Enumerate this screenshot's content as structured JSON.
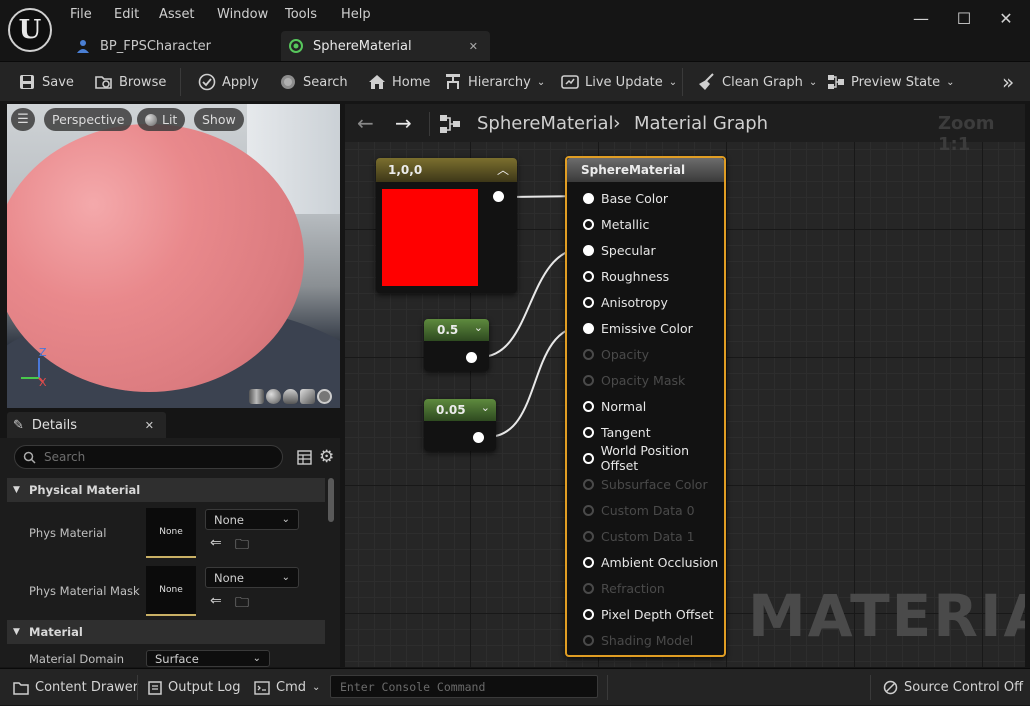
{
  "app": {
    "logo": "U"
  },
  "menu": [
    "File",
    "Edit",
    "Asset",
    "Window",
    "Tools",
    "Help"
  ],
  "window_controls": {
    "minimize": "—",
    "maximize": "☐",
    "close": "✕"
  },
  "tabs": [
    {
      "label": "BP_FPSCharacter",
      "icon": "person-icon"
    },
    {
      "label": "SphereMaterial",
      "icon": "material-icon",
      "active": true,
      "close": "✕"
    }
  ],
  "toolbar": {
    "save": "Save",
    "browse": "Browse",
    "apply": "Apply",
    "search": "Search",
    "home": "Home",
    "hierarchy": "Hierarchy",
    "live_update": "Live Update",
    "clean_graph": "Clean Graph",
    "preview_state": "Preview State",
    "more": "»"
  },
  "viewport": {
    "perspective": "Perspective",
    "lit": "Lit",
    "show": "Show",
    "axis_z": "Z",
    "axis_x": "X",
    "sphere_color": "#e7878a"
  },
  "details": {
    "tab_label": "Details",
    "close": "✕",
    "search_placeholder": "Search",
    "categories": {
      "physical": "Physical Material",
      "material": "Material"
    },
    "phys_material": {
      "label": "Phys Material",
      "thumb": "None",
      "value": "None"
    },
    "phys_material_mask": {
      "label": "Phys Material Mask",
      "thumb": "None",
      "value": "None"
    },
    "material_domain": {
      "label": "Material Domain",
      "value": "Surface"
    }
  },
  "graph": {
    "breadcrumb_root": "SphereMaterial",
    "breadcrumb_sep": "›",
    "breadcrumb_leaf": "Material Graph",
    "zoom": "Zoom 1:1",
    "watermark": "MATERIAL",
    "color_node": {
      "title": "1,0,0",
      "swatch": "#ff0000"
    },
    "const1": {
      "value": "0.5"
    },
    "const2": {
      "value": "0.05"
    },
    "result_node": {
      "title": "SphereMaterial",
      "pins": [
        {
          "label": "Base Color",
          "state": "connected"
        },
        {
          "label": "Metallic",
          "state": "open"
        },
        {
          "label": "Specular",
          "state": "connected"
        },
        {
          "label": "Roughness",
          "state": "open"
        },
        {
          "label": "Anisotropy",
          "state": "open"
        },
        {
          "label": "Emissive Color",
          "state": "connected"
        },
        {
          "label": "Opacity",
          "state": "disabled"
        },
        {
          "label": "Opacity Mask",
          "state": "disabled"
        },
        {
          "label": "Normal",
          "state": "open"
        },
        {
          "label": "Tangent",
          "state": "open"
        },
        {
          "label": "World Position Offset",
          "state": "open"
        },
        {
          "label": "Subsurface Color",
          "state": "disabled"
        },
        {
          "label": "Custom Data 0",
          "state": "disabled"
        },
        {
          "label": "Custom Data 1",
          "state": "disabled"
        },
        {
          "label": "Ambient Occlusion",
          "state": "open"
        },
        {
          "label": "Refraction",
          "state": "disabled"
        },
        {
          "label": "Pixel Depth Offset",
          "state": "open"
        },
        {
          "label": "Shading Model",
          "state": "disabled"
        }
      ]
    }
  },
  "statusbar": {
    "content_drawer": "Content Drawer",
    "output_log": "Output Log",
    "cmd": "Cmd",
    "console_placeholder": "Enter Console Command",
    "source_control": "Source Control Off"
  }
}
